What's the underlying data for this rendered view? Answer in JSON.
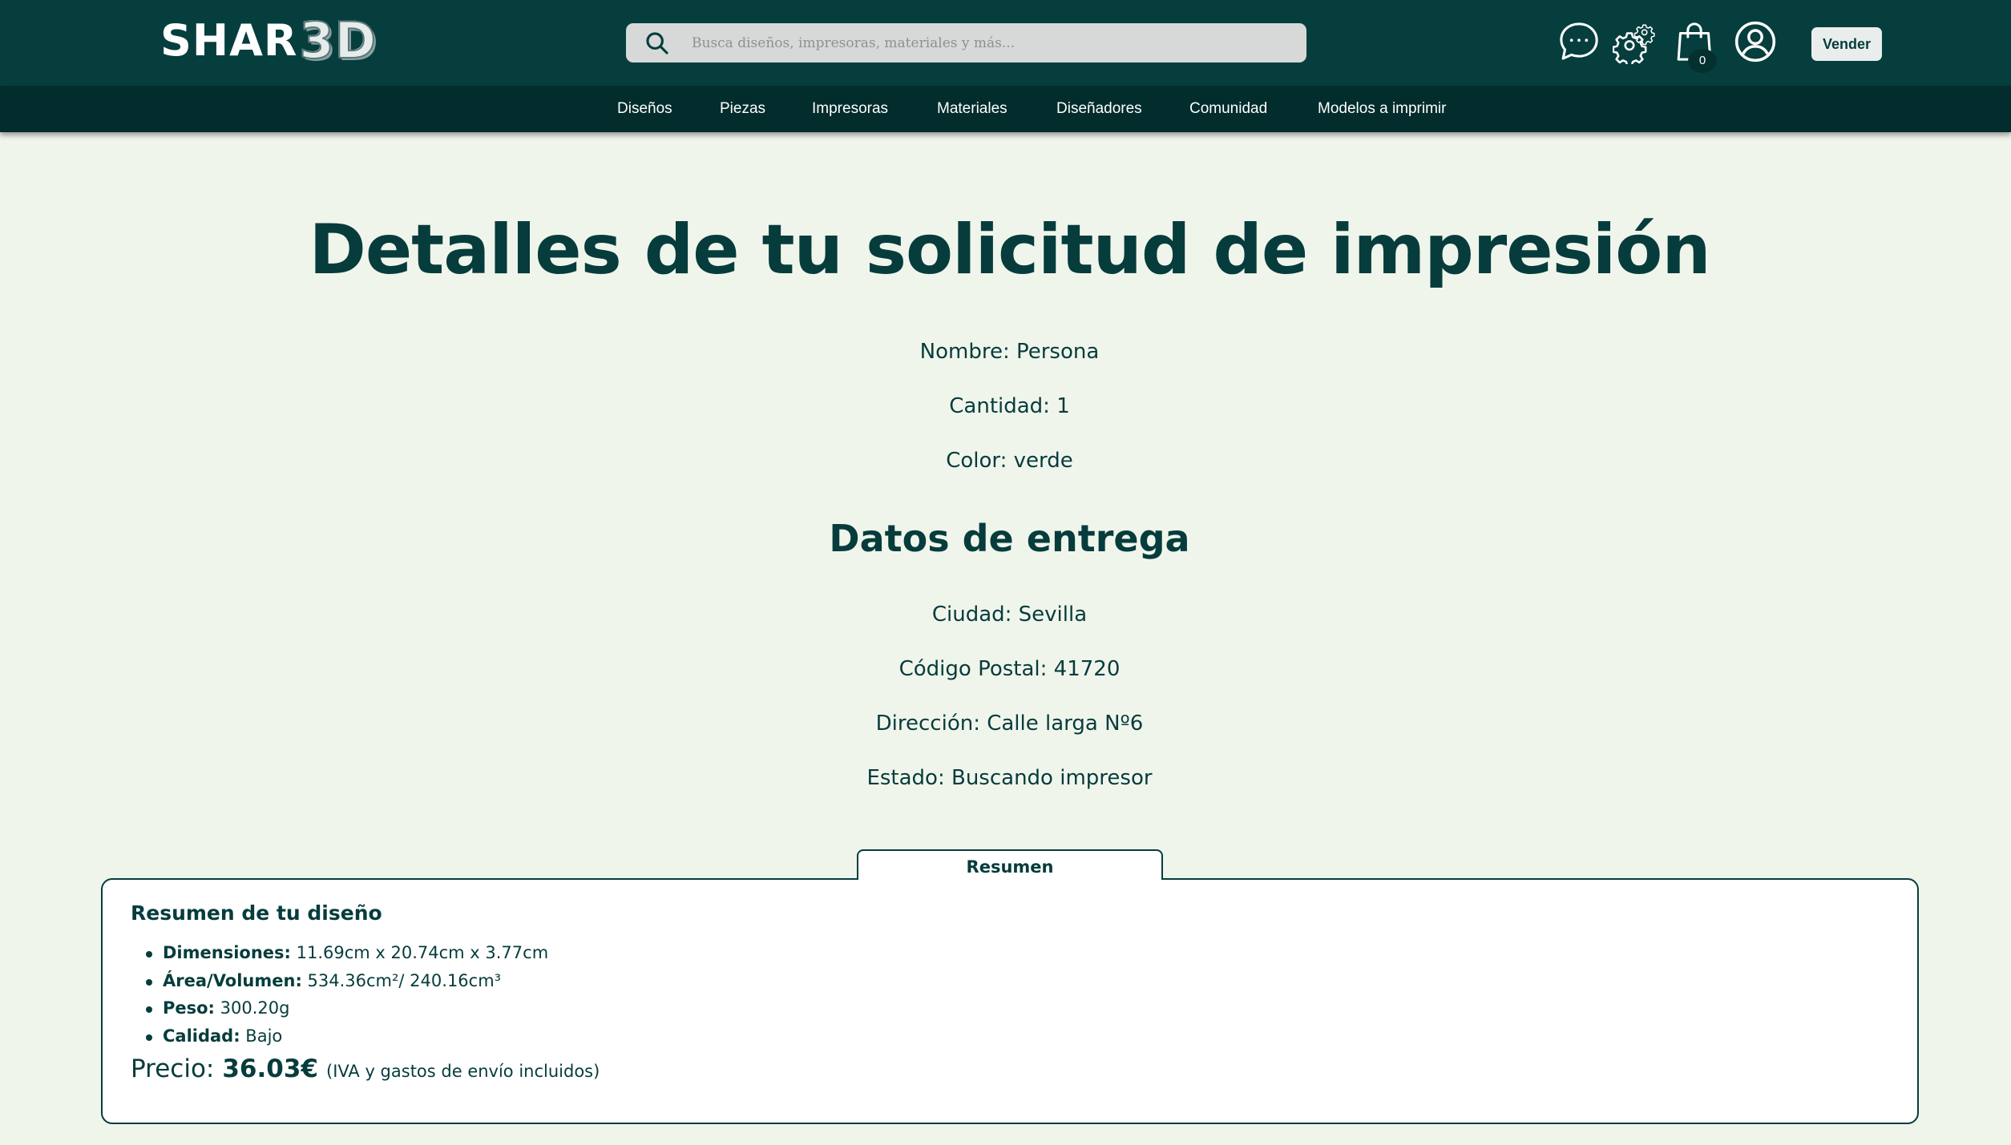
{
  "header": {
    "logo_text": "SHAR",
    "logo_accent": "3D",
    "search_placeholder": "Busca diseños, impresoras, materiales y más...",
    "cart_count": "0",
    "sell_label": "Vender",
    "icons": [
      "chat-icon",
      "gears-icon",
      "shopping-bag-icon",
      "user-profile-icon"
    ]
  },
  "nav": {
    "items": [
      "Diseños",
      "Piezas",
      "Impresoras",
      "Materiales",
      "Diseñadores",
      "Comunidad",
      "Modelos a imprimir"
    ]
  },
  "main": {
    "title": "Detalles de tu solicitud de impresión",
    "name_line": "Nombre: Persona",
    "quantity_line": "Cantidad: 1",
    "color_line": "Color: verde",
    "delivery_title": "Datos de entrega",
    "city_line": "Ciudad: Sevilla",
    "postal_line": "Código Postal: 41720",
    "address_line": "Dirección: Calle larga Nº6",
    "status_line": "Estado: Buscando impresor"
  },
  "summary": {
    "tab_label": "Resumen",
    "heading": "Resumen de tu diseño",
    "dimensions_label": "Dimensiones:",
    "dimensions_value": " 11.69cm x 20.74cm x 3.77cm",
    "area_label": "Área/Volumen:",
    "area_value": " 534.36cm²/ 240.16cm³",
    "weight_label": "Peso:",
    "weight_value": " 300.20g",
    "quality_label": "Calidad:",
    "quality_value": " Bajo",
    "price_label": "Precio:",
    "price_value": "36.03€",
    "price_note": "(IVA y gastos de envío incluidos)"
  },
  "colors": {
    "header_bg": "#063e3e",
    "nav_bg": "#032c2c",
    "page_bg": "#f0f5ec",
    "text_primary": "#063c3c"
  }
}
